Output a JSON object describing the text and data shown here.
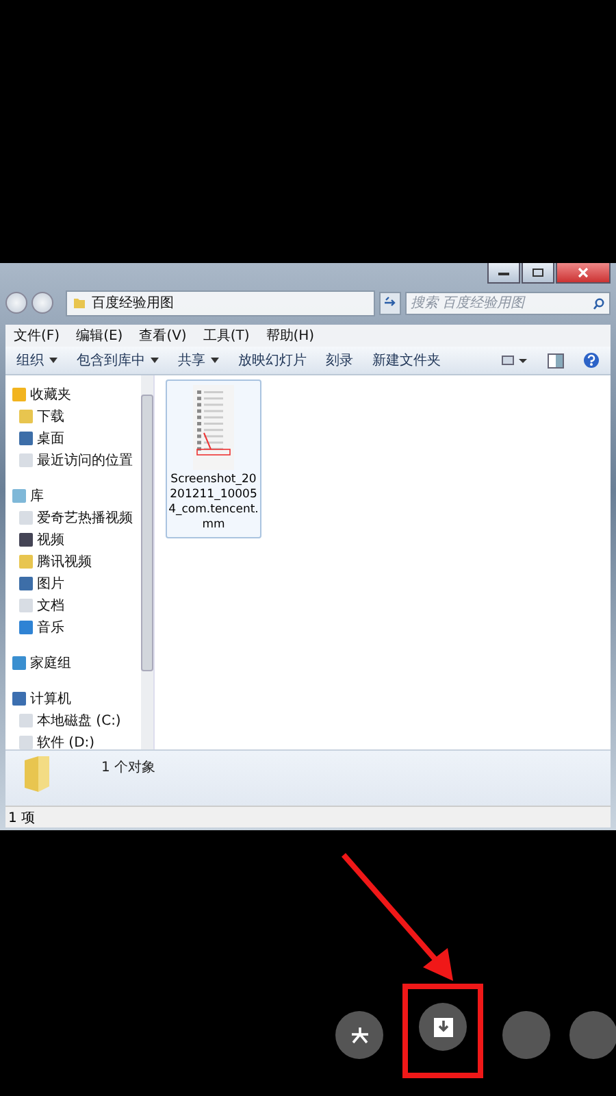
{
  "address": {
    "path": "百度经验用图",
    "search_placeholder": "搜索 百度经验用图"
  },
  "menu": [
    "文件(F)",
    "编辑(E)",
    "查看(V)",
    "工具(T)",
    "帮助(H)"
  ],
  "toolbar": [
    {
      "label": "组织",
      "dropdown": true
    },
    {
      "label": "包含到库中",
      "dropdown": true
    },
    {
      "label": "共享",
      "dropdown": true
    },
    {
      "label": "放映幻灯片",
      "dropdown": false
    },
    {
      "label": "刻录",
      "dropdown": false
    },
    {
      "label": "新建文件夹",
      "dropdown": false
    }
  ],
  "sidebar": [
    {
      "label": "收藏夹",
      "children": [
        {
          "label": "下载"
        },
        {
          "label": "桌面"
        },
        {
          "label": "最近访问的位置"
        }
      ]
    },
    {
      "label": "库",
      "children": [
        {
          "label": "爱奇艺热播视频"
        },
        {
          "label": "视频"
        },
        {
          "label": "腾讯视频"
        },
        {
          "label": "图片"
        },
        {
          "label": "文档"
        },
        {
          "label": "音乐"
        }
      ]
    },
    {
      "label": "家庭组"
    },
    {
      "label": "计算机",
      "children": [
        {
          "label": "本地磁盘 (C:)"
        },
        {
          "label": "软件 (D:)"
        }
      ]
    }
  ],
  "files": [
    {
      "name": "Screenshot_20201211_100054_com.tencent.mm",
      "selected": true
    }
  ],
  "details": {
    "text": "1 个对象"
  },
  "status_bar": "1 项"
}
